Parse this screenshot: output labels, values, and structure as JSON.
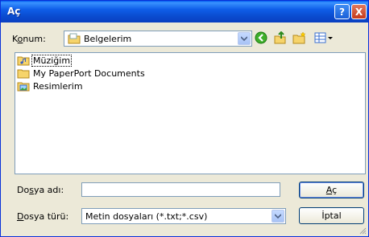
{
  "window": {
    "title": "Aç"
  },
  "titlebar": {
    "help_label": "?",
    "close_label": "X"
  },
  "location": {
    "label_pre": "K",
    "label_ul": "o",
    "label_post": "num:",
    "value": "Belgelerim"
  },
  "toolbar": {
    "icons": [
      "back-icon",
      "up-folder-icon",
      "new-folder-icon",
      "views-icon"
    ]
  },
  "files": [
    {
      "name": "Müziğim",
      "icon": "music-folder-icon"
    },
    {
      "name": "My PaperPort Documents",
      "icon": "folder-icon"
    },
    {
      "name": "Resimlerim",
      "icon": "pictures-folder-icon"
    }
  ],
  "filename": {
    "label_pre": "Do",
    "label_ul": "s",
    "label_post": "ya adı:",
    "value": ""
  },
  "filetype": {
    "label_pre": "",
    "label_ul": "D",
    "label_post": "osya türü:",
    "value": "Metin dosyaları (*.txt;*.csv)"
  },
  "buttons": {
    "open_ul": "A",
    "open_post": "ç",
    "cancel": "İptal"
  },
  "colors": {
    "titlebar": "#0a4cd0",
    "dialog_bg": "#ece9d8",
    "border": "#7f9db9"
  }
}
